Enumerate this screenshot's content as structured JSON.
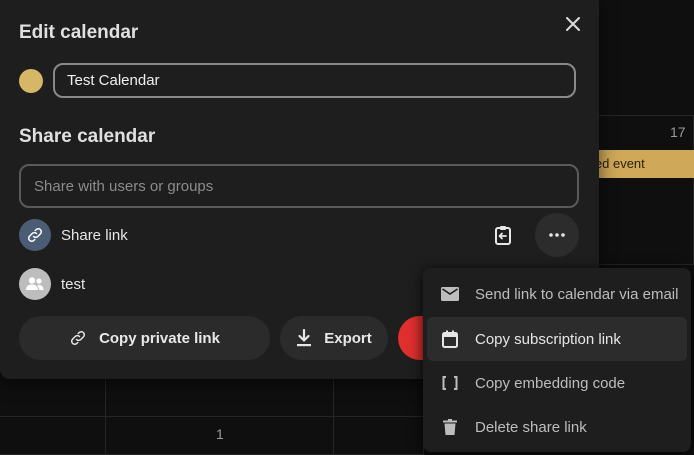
{
  "background": {
    "day_number_top": "17",
    "day_number_bottom": "1",
    "event_text": "led event",
    "event_color": "#cfa859"
  },
  "dialog": {
    "edit_title": "Edit calendar",
    "calendar_color": "#d6b667",
    "calendar_name": "Test Calendar",
    "share_title": "Share calendar",
    "share_placeholder": "Share with users or groups",
    "share_link_label": "Share link",
    "shared_user": "test",
    "copy_private_link": "Copy private link",
    "export_label": "Export"
  },
  "menu": {
    "items": [
      {
        "label": "Send link to calendar via email",
        "icon": "email-icon"
      },
      {
        "label": "Copy subscription link",
        "icon": "calendar-icon"
      },
      {
        "label": "Copy embedding code",
        "icon": "brackets-icon"
      },
      {
        "label": "Delete share link",
        "icon": "trash-icon"
      }
    ]
  },
  "colors": {
    "danger": "#e02f2f",
    "surface": "#1e1e1e"
  }
}
